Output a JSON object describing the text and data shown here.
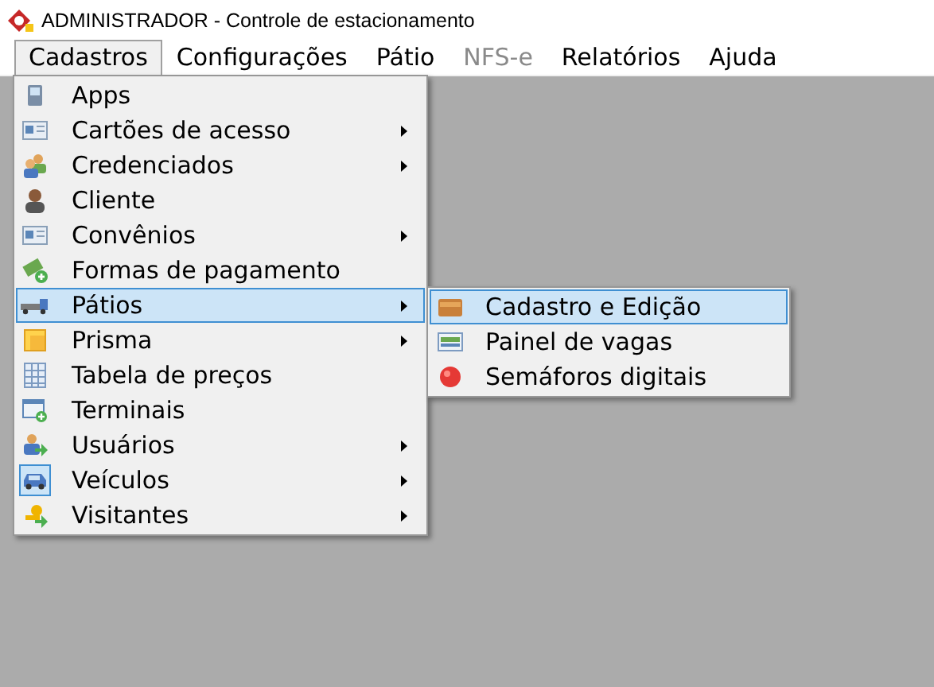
{
  "window": {
    "title": "ADMINISTRADOR - Controle de estacionamento"
  },
  "menubar": [
    {
      "label": "Cadastros",
      "selected": true,
      "disabled": false
    },
    {
      "label": "Configurações",
      "selected": false,
      "disabled": false
    },
    {
      "label": "Pátio",
      "selected": false,
      "disabled": false
    },
    {
      "label": "NFS-e",
      "selected": false,
      "disabled": true
    },
    {
      "label": "Relatórios",
      "selected": false,
      "disabled": false
    },
    {
      "label": "Ajuda",
      "selected": false,
      "disabled": false
    }
  ],
  "menu": {
    "items": [
      {
        "label": "Apps",
        "submenu": false,
        "selected": false,
        "checked": false
      },
      {
        "label": "Cartões de acesso",
        "submenu": true,
        "selected": false,
        "checked": false
      },
      {
        "label": "Credenciados",
        "submenu": true,
        "selected": false,
        "checked": false
      },
      {
        "label": "Cliente",
        "submenu": false,
        "selected": false,
        "checked": false
      },
      {
        "label": "Convênios",
        "submenu": true,
        "selected": false,
        "checked": false
      },
      {
        "label": "Formas de pagamento",
        "submenu": false,
        "selected": false,
        "checked": false
      },
      {
        "label": "Pátios",
        "submenu": true,
        "selected": true,
        "checked": false
      },
      {
        "label": "Prisma",
        "submenu": true,
        "selected": false,
        "checked": false
      },
      {
        "label": "Tabela de preços",
        "submenu": false,
        "selected": false,
        "checked": false
      },
      {
        "label": "Terminais",
        "submenu": false,
        "selected": false,
        "checked": false
      },
      {
        "label": "Usuários",
        "submenu": true,
        "selected": false,
        "checked": false
      },
      {
        "label": "Veículos",
        "submenu": true,
        "selected": false,
        "checked": true
      },
      {
        "label": "Visitantes",
        "submenu": true,
        "selected": false,
        "checked": false
      }
    ]
  },
  "submenu": {
    "items": [
      {
        "label": "Cadastro e Edição",
        "selected": true
      },
      {
        "label": "Painel de vagas",
        "selected": false
      },
      {
        "label": "Semáforos digitais",
        "selected": false
      }
    ]
  }
}
